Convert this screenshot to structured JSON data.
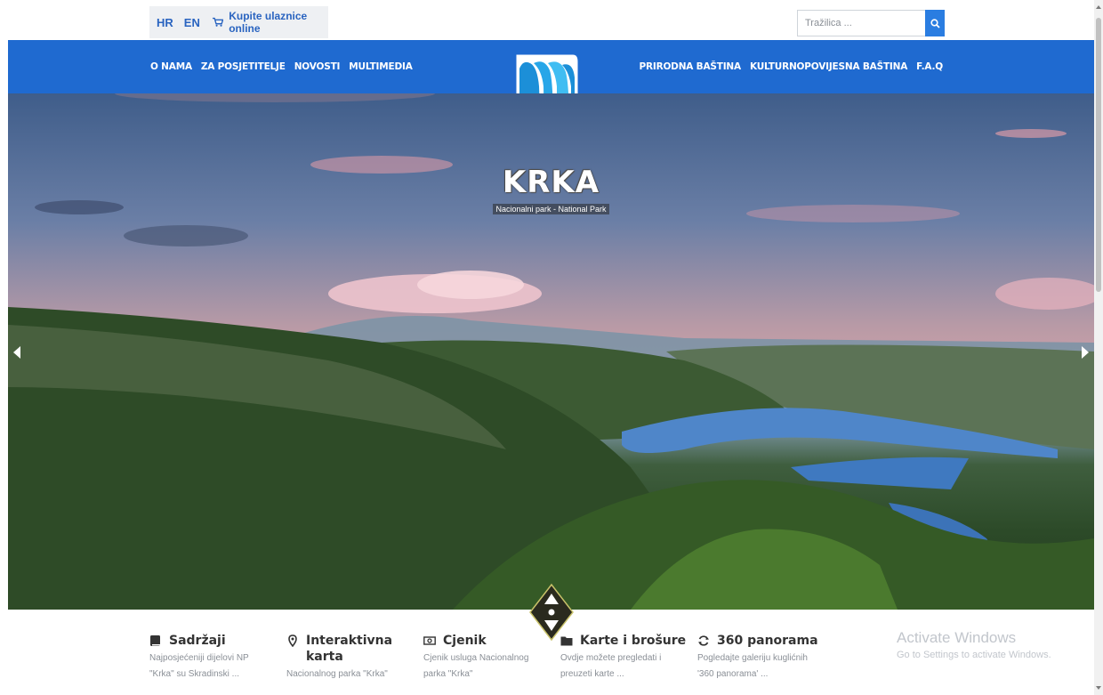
{
  "topbar": {
    "languages": [
      "HR",
      "EN"
    ],
    "buy_tickets": "Kupite ulaznice online",
    "search_placeholder": "Tražilica ..."
  },
  "nav": {
    "left": [
      "O NAMA",
      "ZA POSJETITELJE",
      "NOVOSTI",
      "MULTIMEDIA"
    ],
    "right": [
      "PRIRODNA BAŠTINA",
      "KULTURNOPOVIJESNA BAŠTINA",
      "F.A.Q"
    ]
  },
  "hero": {
    "title": "KRKA",
    "subtitle": "Nacionalni park - National Park"
  },
  "features": [
    {
      "icon": "book-icon",
      "title": "Sadržaji",
      "desc": "Najposjećeniji dijelovi NP \"Krka\" su Skradinski ..."
    },
    {
      "icon": "map-marker-icon",
      "title": "Interaktivna karta",
      "desc": "Nacionalnog parka \"Krka\""
    },
    {
      "icon": "money-icon",
      "title": "Cjenik",
      "desc": "Cjenik usluga Nacionalnog parka \"Krka\""
    },
    {
      "icon": "folder-icon",
      "title": "Karte i brošure",
      "desc": "Ovdje možete pregledati i preuzeti karte ..."
    },
    {
      "icon": "refresh-icon",
      "title": "360 panorama",
      "desc": "Pogledajte galeriju kuglićnih '360 panorama' ..."
    }
  ],
  "watermark": {
    "title": "Activate Windows",
    "subtitle": "Go to Settings to activate Windows."
  },
  "colors": {
    "nav_blue": "#1f6ad0",
    "link_blue": "#2a64c0",
    "search_button": "#2a7de1"
  }
}
